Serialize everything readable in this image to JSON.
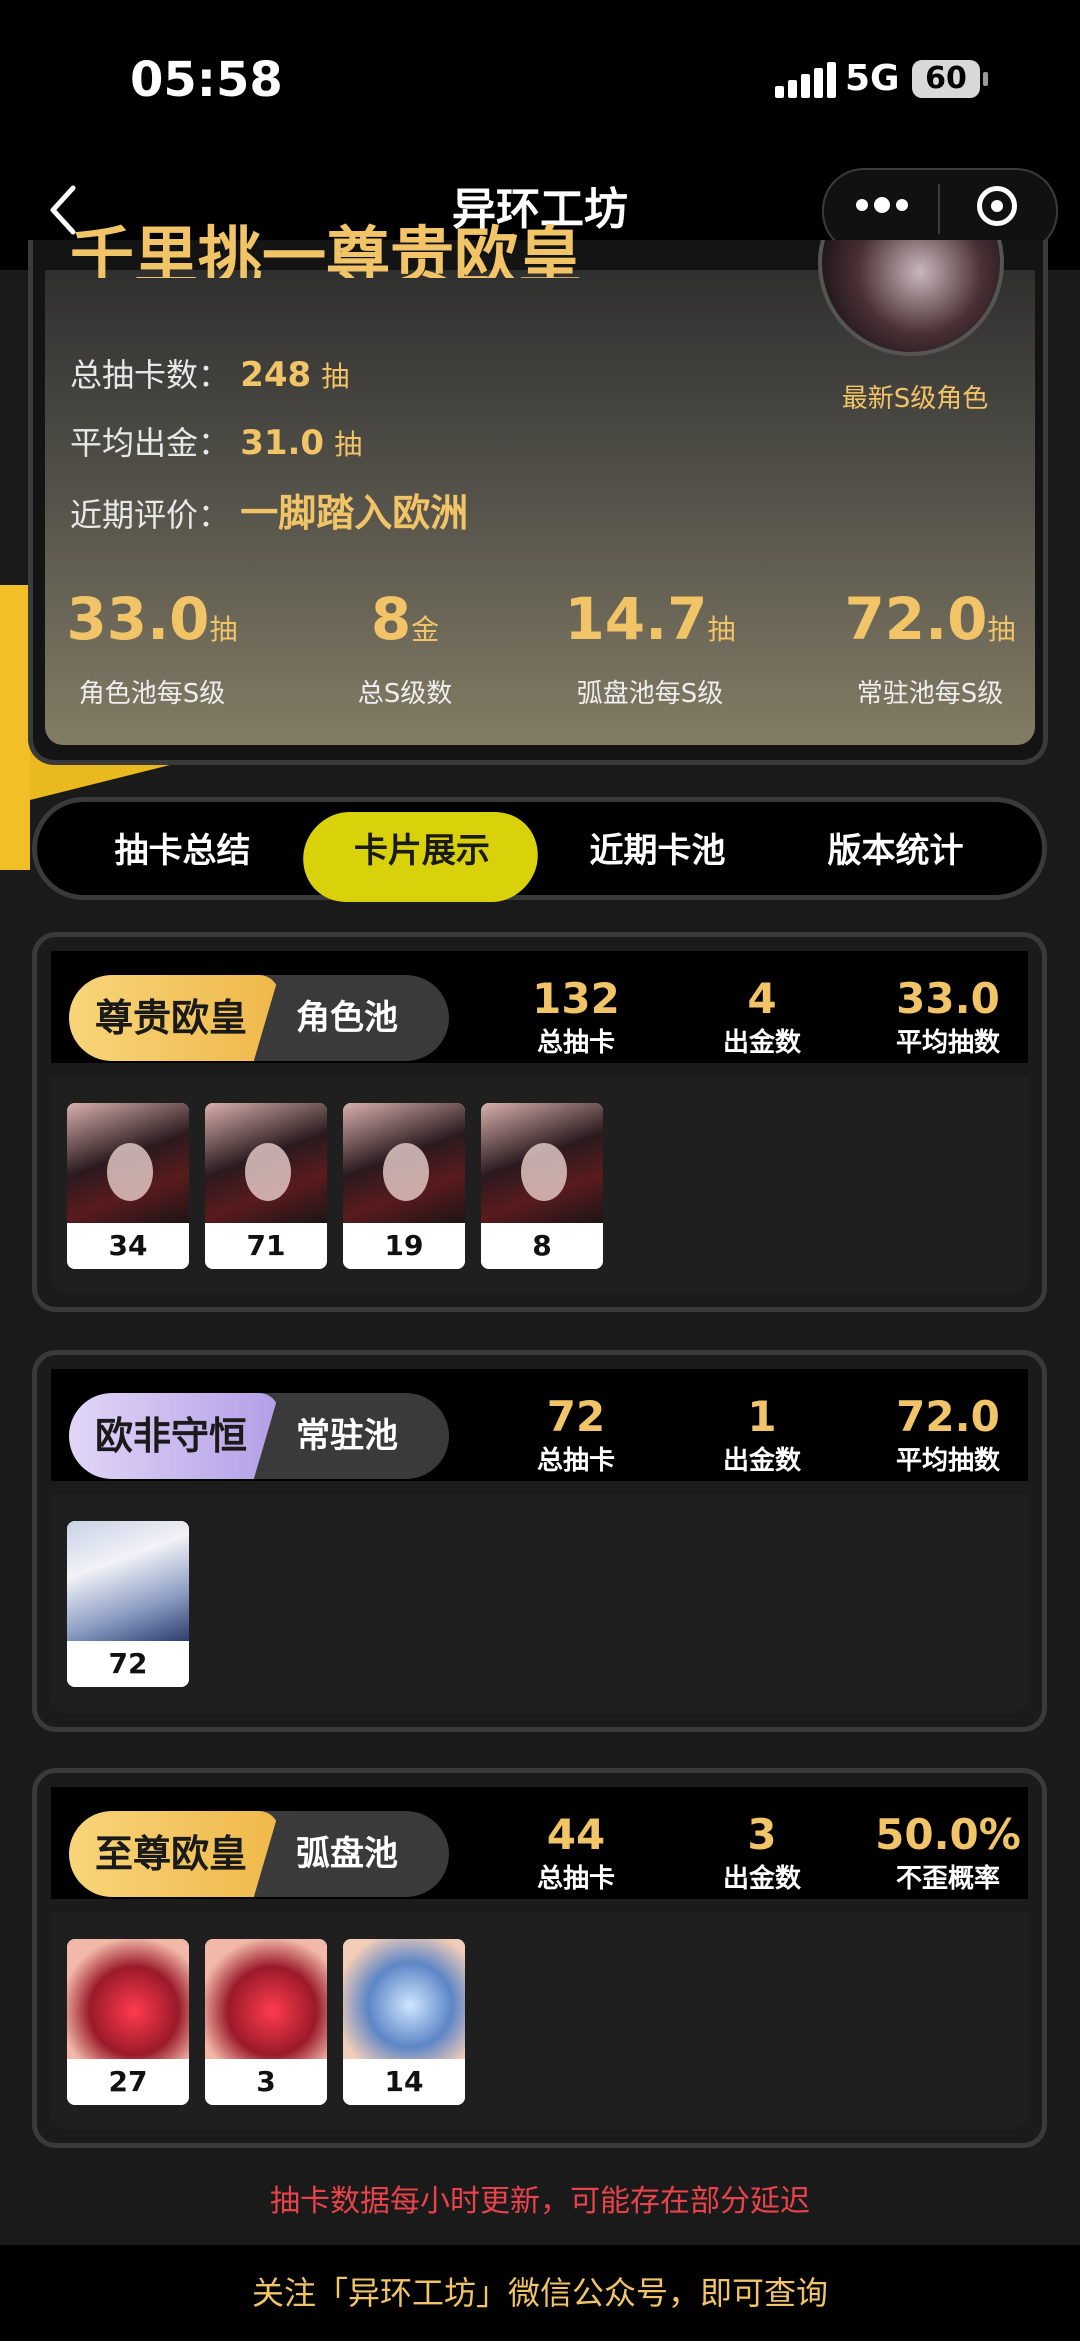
{
  "status_bar": {
    "time": "05:58",
    "network": "5G",
    "battery": "60"
  },
  "nav": {
    "title": "异环工坊"
  },
  "summary": {
    "title": "千里挑一尊贵欧皇",
    "total_pulls_label": "总抽卡数：",
    "total_pulls_value": "248",
    "total_pulls_unit": "抽",
    "avg_gold_label": "平均出金：",
    "avg_gold_value": "31.0",
    "avg_gold_unit": "抽",
    "recent_eval_label": "近期评价：",
    "recent_eval_value": "一脚踏入欧洲",
    "latest_s_label": "最新S级角色",
    "metrics": [
      {
        "value": "33.0",
        "unit": "抽",
        "label": "角色池每S级"
      },
      {
        "value": "8",
        "unit": "金",
        "label": "总S级数"
      },
      {
        "value": "14.7",
        "unit": "抽",
        "label": "弧盘池每S级"
      },
      {
        "value": "72.0",
        "unit": "抽",
        "label": "常驻池每S级"
      }
    ]
  },
  "tabs": [
    {
      "label": "抽卡总结"
    },
    {
      "label": "卡片展示"
    },
    {
      "label": "近期卡池"
    },
    {
      "label": "版本统计"
    }
  ],
  "pools": [
    {
      "rank": "尊贵欧皇",
      "pool_name": "角色池",
      "stats": [
        {
          "value": "132",
          "label": "总抽卡"
        },
        {
          "value": "4",
          "label": "出金数"
        },
        {
          "value": "33.0",
          "label": "平均抽数"
        }
      ],
      "cards": [
        "34",
        "71",
        "19",
        "8"
      ]
    },
    {
      "rank": "欧非守恒",
      "pool_name": "常驻池",
      "stats": [
        {
          "value": "72",
          "label": "总抽卡"
        },
        {
          "value": "1",
          "label": "出金数"
        },
        {
          "value": "72.0",
          "label": "平均抽数"
        }
      ],
      "cards": [
        "72"
      ]
    },
    {
      "rank": "至尊欧皇",
      "pool_name": "弧盘池",
      "stats": [
        {
          "value": "44",
          "label": "总抽卡"
        },
        {
          "value": "3",
          "label": "出金数"
        },
        {
          "value": "50.0%",
          "label": "不歪概率"
        }
      ],
      "cards": [
        "27",
        "3",
        "14"
      ]
    }
  ],
  "footer": {
    "note": "抽卡数据每小时更新，可能存在部分延迟",
    "follow": "关注「异环工坊」微信公众号，即可查询"
  },
  "colors": {
    "accent": "#f2c468",
    "active_tab": "#d9d20a",
    "warning": "#e8434a"
  }
}
